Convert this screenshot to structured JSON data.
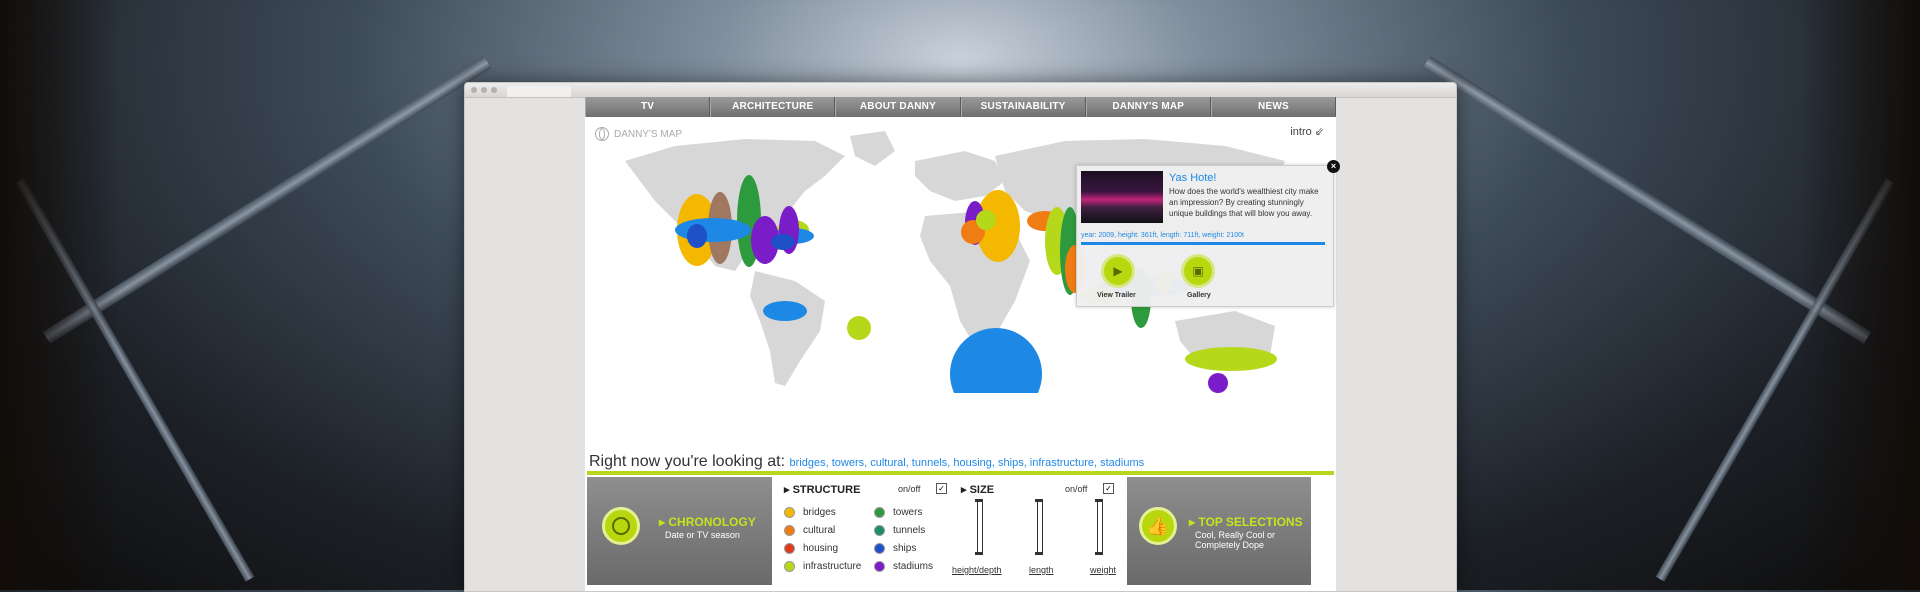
{
  "nav": [
    "TV",
    "ARCHITECTURE",
    "ABOUT DANNY",
    "SUSTAINABILITY",
    "DANNY'S MAP",
    "NEWS"
  ],
  "map_header": {
    "title": "DANNY'S MAP",
    "intro": "intro ⇙"
  },
  "looking_at": {
    "label": "Right now you're looking at:",
    "categories": "bridges, towers, cultural, tunnels, housing, ships, infrastructure, stadiums"
  },
  "popup": {
    "title": "Yas Hote!",
    "description": "How does the world's wealthiest city make an impression? By creating stunningly unique buildings that will blow you away.",
    "stats": "year: 2009, height: 361ft, length: 711ft, weight: 2100t",
    "btn_trailer": "View Trailer",
    "btn_gallery": "Gallery"
  },
  "chronology": {
    "title": "CHRONOLOGY",
    "subtitle": "Date or TV season"
  },
  "structure": {
    "title": "STRUCTURE",
    "onoff": "on/off",
    "items": [
      {
        "label": "bridges",
        "color": "#f5b800"
      },
      {
        "label": "cultural",
        "color": "#f07c14"
      },
      {
        "label": "housing",
        "color": "#e03a1c"
      },
      {
        "label": "infrastructure",
        "color": "#b6d81a"
      },
      {
        "label": "towers",
        "color": "#2e9a3e"
      },
      {
        "label": "tunnels",
        "color": "#1a8d6a"
      },
      {
        "label": "ships",
        "color": "#1e50c8"
      },
      {
        "label": "stadiums",
        "color": "#7a1cc8"
      }
    ]
  },
  "size": {
    "title": "SIZE",
    "onoff": "on/off",
    "sliders": [
      "height/depth",
      "length",
      "weight"
    ]
  },
  "top_selections": {
    "title": "TOP SELECTIONS",
    "subtitle": "Cool, Really Cool or Completely Dope"
  }
}
